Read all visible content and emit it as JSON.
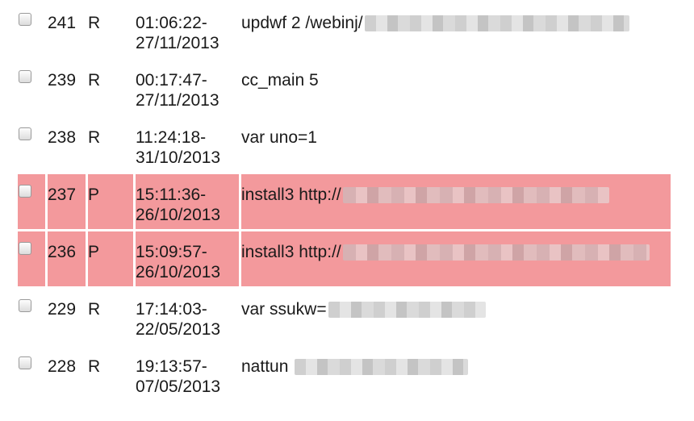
{
  "rows": [
    {
      "id": "241",
      "status": "R",
      "time": "01:06:22-",
      "date": "27/11/2013",
      "command": "updwf 2 /webinj/",
      "highlighted": false,
      "redacted": true
    },
    {
      "id": "239",
      "status": "R",
      "time": "00:17:47-",
      "date": "27/11/2013",
      "command": "cc_main 5",
      "highlighted": false,
      "redacted": false
    },
    {
      "id": "238",
      "status": "R",
      "time": "11:24:18-",
      "date": "31/10/2013",
      "command": "var uno=1",
      "highlighted": false,
      "redacted": false
    },
    {
      "id": "237",
      "status": "P",
      "time": "15:11:36-",
      "date": "26/10/2013",
      "command": "install3 http://",
      "highlighted": true,
      "redacted": true
    },
    {
      "id": "236",
      "status": "P",
      "time": "15:09:57-",
      "date": "26/10/2013",
      "command": "install3 http://",
      "highlighted": true,
      "redacted": true
    },
    {
      "id": "229",
      "status": "R",
      "time": "17:14:03-",
      "date": "22/05/2013",
      "command": "var ssukw=",
      "highlighted": false,
      "redacted": true
    },
    {
      "id": "228",
      "status": "R",
      "time": "19:13:57-",
      "date": "07/05/2013",
      "command": "nattun",
      "highlighted": false,
      "redacted": true
    }
  ],
  "colors": {
    "highlight_row": "#f3999c",
    "text": "#1a1a1a",
    "background": "#ffffff"
  }
}
